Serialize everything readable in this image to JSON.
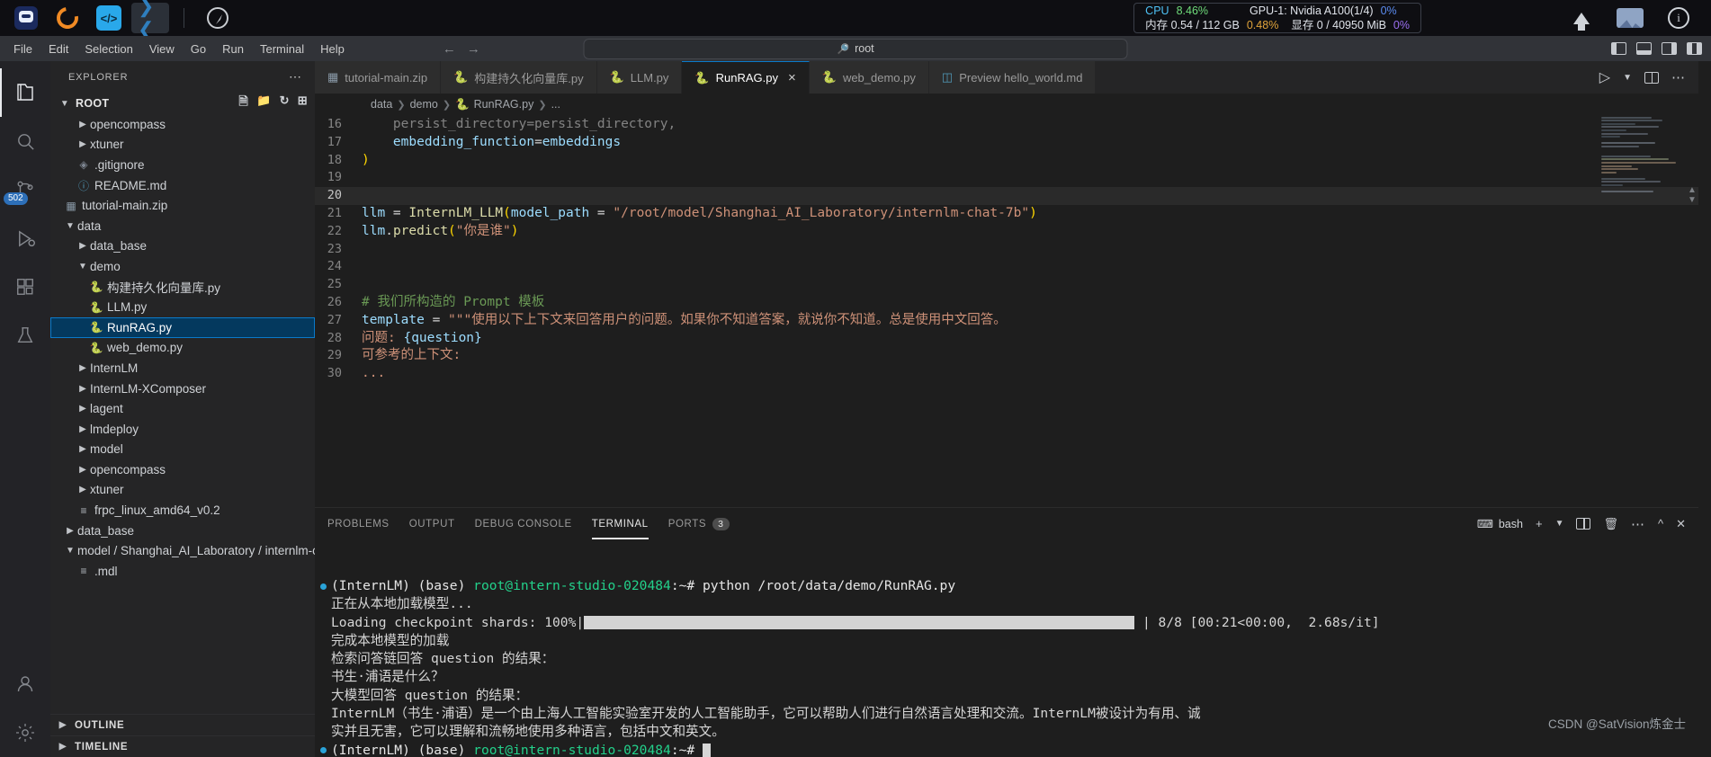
{
  "osbar": {
    "icons": [
      {
        "name": "robot-app-icon",
        "label": "InternLM"
      },
      {
        "name": "ring-app-icon",
        "label": "Ring"
      },
      {
        "name": "code-app-icon",
        "label": "Code"
      },
      {
        "name": "vscode-app-icon",
        "label": "VS Code"
      },
      {
        "name": "compass-icon",
        "label": "Compass"
      }
    ],
    "sysmon": {
      "cpu_label": "CPU",
      "cpu_value": "8.46%",
      "gpu_label": "GPU-1: Nvidia A100(1/4)",
      "gpu_value": "0%",
      "mem_label": "内存 0.54 / 112 GB",
      "mem_value": "0.48%",
      "vram_label": "显存 0 / 40950 MiB",
      "vram_value": "0%"
    },
    "tray": [
      "upload-icon",
      "image-icon",
      "info-icon"
    ],
    "colors": {
      "cpu": "#6fdc7a",
      "gpu": "#5b8cf0",
      "mem": "#e0a33a",
      "vram": "#9b6ff0",
      "label": "#4fc3f7"
    }
  },
  "menubar": {
    "items": [
      "File",
      "Edit",
      "Selection",
      "View",
      "Go",
      "Run",
      "Terminal",
      "Help"
    ],
    "back_icon": "arrow-left-icon",
    "forward_icon": "arrow-right-icon",
    "command_center_text": "root",
    "command_center_icon": "search-icon",
    "layout_icons": [
      "toggle-primary-sidebar-icon",
      "toggle-panel-icon",
      "toggle-secondary-sidebar-icon",
      "customize-layout-icon"
    ]
  },
  "activitybar": {
    "items": [
      {
        "name": "explorer",
        "icon": "files-icon",
        "selected": true,
        "badge": null
      },
      {
        "name": "search",
        "icon": "search-icon",
        "selected": false,
        "badge": null
      },
      {
        "name": "source-control",
        "icon": "source-control-icon",
        "selected": false,
        "badge": "502"
      },
      {
        "name": "run-and-debug",
        "icon": "debug-icon",
        "selected": false,
        "badge": null
      },
      {
        "name": "extensions",
        "icon": "extensions-icon",
        "selected": false,
        "badge": null
      },
      {
        "name": "testing",
        "icon": "beaker-icon",
        "selected": false,
        "badge": null
      }
    ],
    "bottom": [
      {
        "name": "accounts",
        "icon": "account-icon"
      },
      {
        "name": "settings",
        "icon": "gear-icon"
      }
    ]
  },
  "explorer": {
    "title": "EXPLORER",
    "more_icon": "ellipsis-icon",
    "root_label": "ROOT",
    "root_actions": [
      "new-file-icon",
      "new-folder-icon",
      "refresh-icon",
      "collapse-all-icon"
    ],
    "tree": [
      {
        "label": "opencompass",
        "type": "folder",
        "expanded": false,
        "indent": 2,
        "selected": false
      },
      {
        "label": "xtuner",
        "type": "folder",
        "expanded": false,
        "indent": 2,
        "selected": false
      },
      {
        "label": ".gitignore",
        "type": "git",
        "indent": 2,
        "selected": false
      },
      {
        "label": "README.md",
        "type": "md",
        "indent": 2,
        "selected": false
      },
      {
        "label": "tutorial-main.zip",
        "type": "zip",
        "indent": 1,
        "selected": false
      },
      {
        "label": "data",
        "type": "folder",
        "expanded": true,
        "indent": 1,
        "selected": false
      },
      {
        "label": "data_base",
        "type": "folder",
        "expanded": false,
        "indent": 2,
        "selected": false
      },
      {
        "label": "demo",
        "type": "folder",
        "expanded": true,
        "indent": 2,
        "selected": false
      },
      {
        "label": "构建持久化向量库.py",
        "type": "py",
        "indent": 3,
        "selected": false
      },
      {
        "label": "LLM.py",
        "type": "py",
        "indent": 3,
        "selected": false
      },
      {
        "label": "RunRAG.py",
        "type": "py",
        "indent": 3,
        "selected": true
      },
      {
        "label": "web_demo.py",
        "type": "py",
        "indent": 3,
        "selected": false
      },
      {
        "label": "InternLM",
        "type": "folder",
        "expanded": false,
        "indent": 2,
        "selected": false
      },
      {
        "label": "InternLM-XComposer",
        "type": "folder",
        "expanded": false,
        "indent": 2,
        "selected": false
      },
      {
        "label": "lagent",
        "type": "folder",
        "expanded": false,
        "indent": 2,
        "selected": false
      },
      {
        "label": "lmdeploy",
        "type": "folder",
        "expanded": false,
        "indent": 2,
        "selected": false
      },
      {
        "label": "model",
        "type": "folder",
        "expanded": false,
        "indent": 2,
        "selected": false
      },
      {
        "label": "opencompass",
        "type": "folder",
        "expanded": false,
        "indent": 2,
        "selected": false
      },
      {
        "label": "xtuner",
        "type": "folder",
        "expanded": false,
        "indent": 2,
        "selected": false
      },
      {
        "label": "frpc_linux_amd64_v0.2",
        "type": "txt",
        "indent": 2,
        "selected": false
      },
      {
        "label": "data_base",
        "type": "folder",
        "expanded": false,
        "indent": 1,
        "selected": false
      },
      {
        "label": "model / Shanghai_AI_Laboratory / internlm-c...",
        "type": "folder",
        "expanded": true,
        "indent": 1,
        "selected": false
      },
      {
        "label": ".mdl",
        "type": "txt",
        "indent": 2,
        "selected": false
      }
    ],
    "sections": [
      {
        "label": "OUTLINE",
        "expanded": false
      },
      {
        "label": "TIMELINE",
        "expanded": false
      }
    ]
  },
  "editor": {
    "tabs": [
      {
        "label": "tutorial-main.zip",
        "icon": "zip-file-icon",
        "active": false,
        "closable": false
      },
      {
        "label": "构建持久化向量库.py",
        "icon": "python-file-icon",
        "active": false,
        "closable": false
      },
      {
        "label": "LLM.py",
        "icon": "python-file-icon",
        "active": false,
        "closable": false
      },
      {
        "label": "RunRAG.py",
        "icon": "python-file-icon",
        "active": true,
        "closable": true
      },
      {
        "label": "web_demo.py",
        "icon": "python-file-icon",
        "active": false,
        "closable": false
      },
      {
        "label": "Preview hello_world.md",
        "icon": "preview-icon",
        "active": false,
        "closable": false
      }
    ],
    "tab_close_label": "×",
    "actions": [
      "run-icon",
      "run-dropdown-icon",
      "split-editor-icon",
      "more-actions-icon"
    ],
    "breadcrumb": [
      "data",
      "demo",
      "RunRAG.py",
      "..."
    ],
    "breadcrumb_file_icon": "python-file-icon",
    "lines": [
      {
        "no": "16",
        "partial": true,
        "tokens": [
          {
            "t": "    persist_directory=persist_directory,",
            "c": "s-plain"
          }
        ]
      },
      {
        "no": "17",
        "tokens": [
          {
            "t": "    ",
            "c": "s-plain"
          },
          {
            "t": "embedding_function",
            "c": "s-var"
          },
          {
            "t": "=",
            "c": "s-op"
          },
          {
            "t": "embeddings",
            "c": "s-var"
          }
        ]
      },
      {
        "no": "18",
        "tokens": [
          {
            "t": ")",
            "c": "s-par"
          }
        ]
      },
      {
        "no": "19",
        "tokens": []
      },
      {
        "no": "20",
        "tokens": [],
        "current": true
      },
      {
        "no": "21",
        "tokens": [
          {
            "t": "llm ",
            "c": "s-var"
          },
          {
            "t": "= ",
            "c": "s-op"
          },
          {
            "t": "InternLM_LLM",
            "c": "s-fn"
          },
          {
            "t": "(",
            "c": "s-par"
          },
          {
            "t": "model_path",
            "c": "s-var"
          },
          {
            "t": " = ",
            "c": "s-op"
          },
          {
            "t": "\"/root/model/Shanghai_AI_Laboratory/internlm-chat-7b\"",
            "c": "s-str"
          },
          {
            "t": ")",
            "c": "s-par"
          }
        ]
      },
      {
        "no": "22",
        "tokens": [
          {
            "t": "llm",
            "c": "s-var"
          },
          {
            "t": ".",
            "c": "s-op"
          },
          {
            "t": "predict",
            "c": "s-fn"
          },
          {
            "t": "(",
            "c": "s-par"
          },
          {
            "t": "\"你是谁\"",
            "c": "s-str"
          },
          {
            "t": ")",
            "c": "s-par"
          }
        ]
      },
      {
        "no": "23",
        "tokens": []
      },
      {
        "no": "24",
        "tokens": []
      },
      {
        "no": "25",
        "tokens": []
      },
      {
        "no": "26",
        "tokens": [
          {
            "t": "# 我们所构造的 Prompt 模板",
            "c": "s-cmt"
          }
        ]
      },
      {
        "no": "27",
        "tokens": [
          {
            "t": "template ",
            "c": "s-var"
          },
          {
            "t": "= ",
            "c": "s-op"
          },
          {
            "t": "\"\"\"使用以下上下文来回答用户的问题。如果你不知道答案，就说你不知道。总是使用中文回答。",
            "c": "s-str"
          }
        ]
      },
      {
        "no": "28",
        "tokens": [
          {
            "t": "问题: ",
            "c": "s-str"
          },
          {
            "t": "{question}",
            "c": "s-var"
          }
        ]
      },
      {
        "no": "29",
        "tokens": [
          {
            "t": "可参考的上下文:",
            "c": "s-str"
          }
        ]
      },
      {
        "no": "30",
        "tokens": [
          {
            "t": "...",
            "c": "s-str"
          }
        ]
      }
    ]
  },
  "panel": {
    "tabs": [
      {
        "label": "PROBLEMS",
        "active": false,
        "badge": null
      },
      {
        "label": "OUTPUT",
        "active": false,
        "badge": null
      },
      {
        "label": "DEBUG CONSOLE",
        "active": false,
        "badge": null
      },
      {
        "label": "TERMINAL",
        "active": true,
        "badge": null
      },
      {
        "label": "PORTS",
        "active": false,
        "badge": "3"
      }
    ],
    "shell_label": "bash",
    "shell_icon": "terminal-bash-icon",
    "actions": [
      "new-terminal-icon",
      "terminal-dropdown-icon",
      "split-terminal-icon",
      "kill-terminal-icon",
      "more-icon",
      "chevron-up-icon",
      "close-icon"
    ],
    "terminal": {
      "prompt_env": "(InternLM) (base) ",
      "prompt_user": "root@intern-studio-020484",
      "prompt_path": ":~# ",
      "command": "python /root/data/demo/RunRAG.py",
      "output_lines": [
        "正在从本地加载模型...",
        "Loading checkpoint shards: 100%",
        "完成本地模型的加载",
        "检索问答链回答 question 的结果：",
        "书生·浦语是什么？",
        "大模型回答 question 的结果：",
        "InternLM（书生·浦语）是一个由上海人工智能实验室开发的人工智能助手，它可以帮助人们进行自然语言处理和交流。InternLM被设计为有用、诚",
        "实并且无害，它可以理解和流畅地使用多种语言，包括中文和英文。"
      ],
      "progress_suffix": "| 8/8 [00:21<00:00,  2.68s/it]",
      "progress_percent": 100,
      "final_prompt_env": "(InternLM) (base) ",
      "final_prompt_user": "root@intern-studio-020484",
      "final_prompt_path": ":~# "
    },
    "watermark": "CSDN @SatVision炼金士"
  }
}
